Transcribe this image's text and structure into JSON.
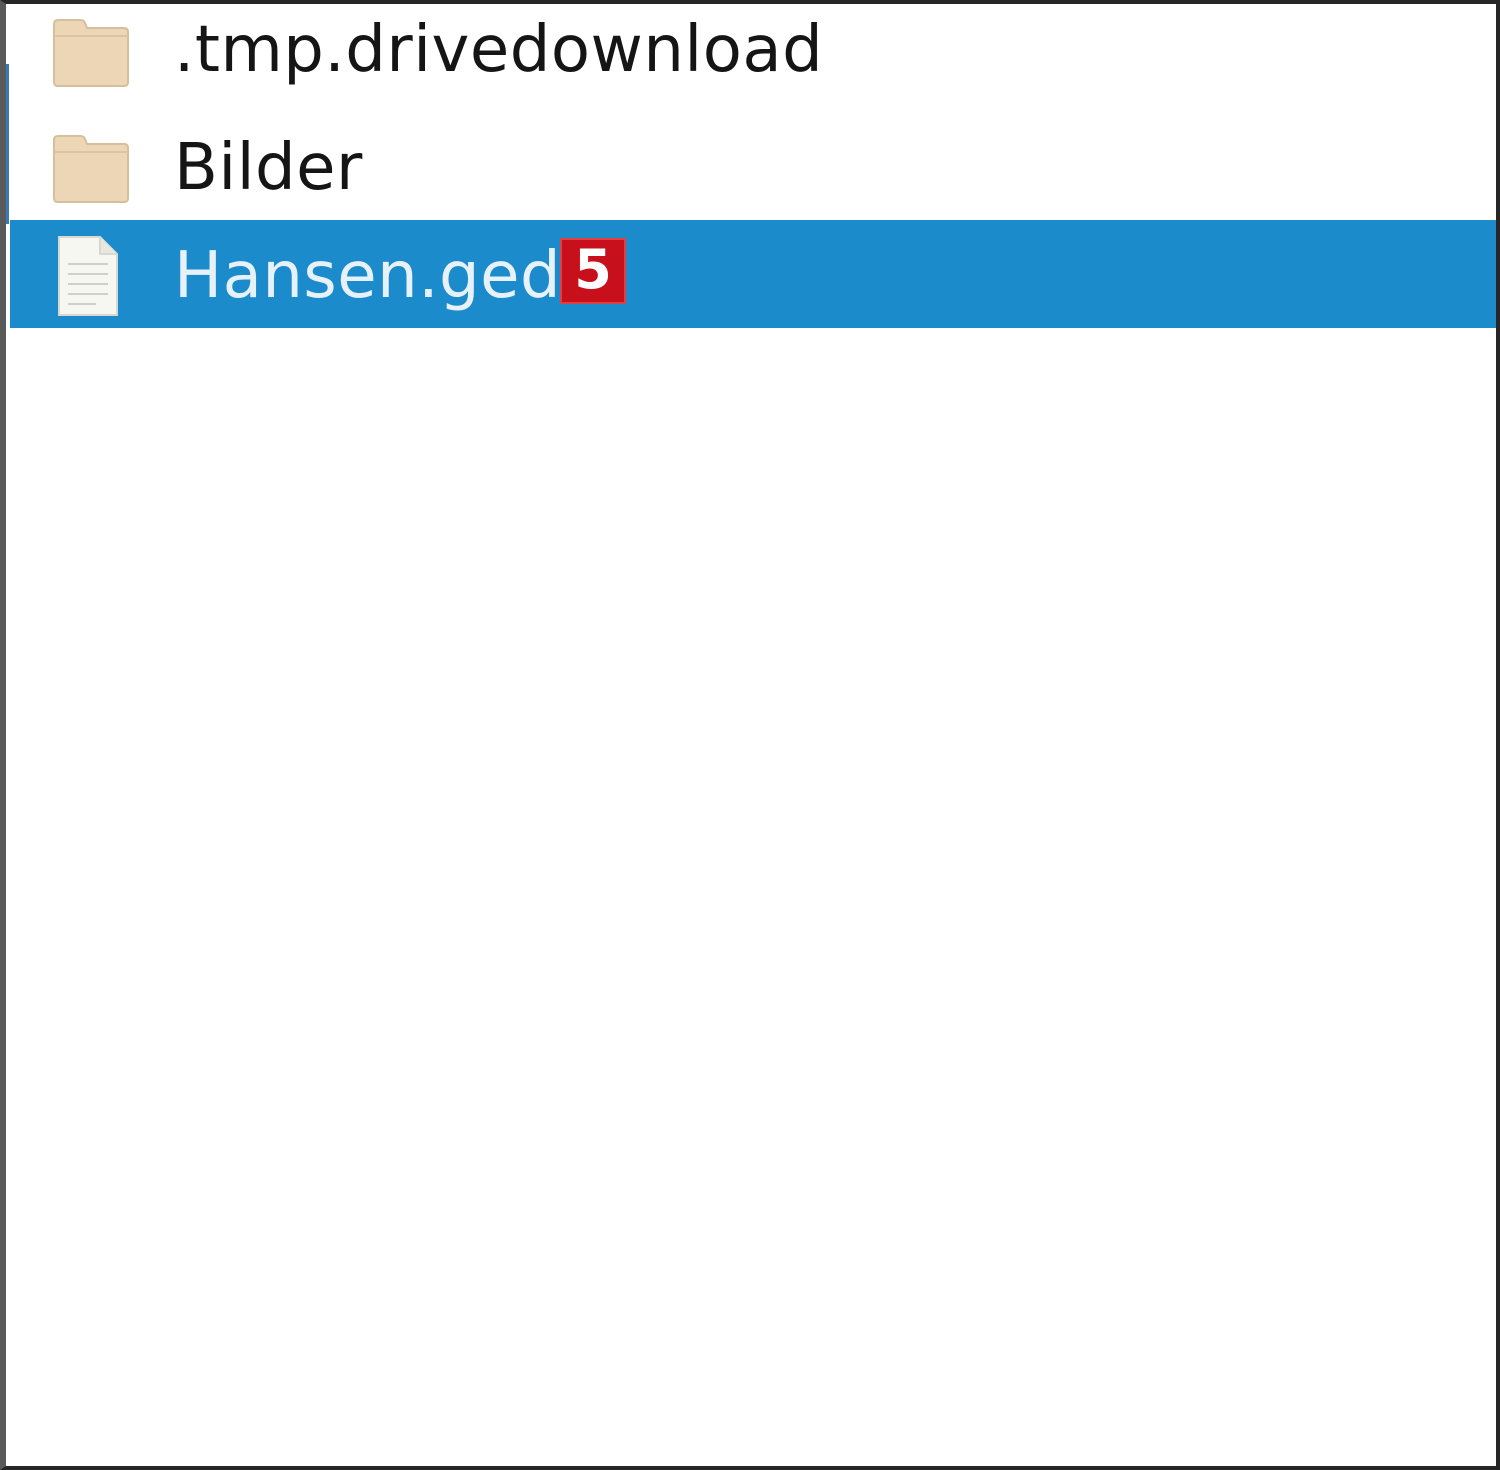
{
  "file_list": {
    "items": [
      {
        "name": ".tmp.drivedownload",
        "icon": "folder-icon",
        "selected": false
      },
      {
        "name": "Bilder",
        "icon": "folder-icon",
        "selected": false
      },
      {
        "name": "Hansen.ged",
        "icon": "document-icon",
        "selected": true,
        "badge": "5"
      }
    ]
  },
  "colors": {
    "selection": "#1c8bcc",
    "badge": "#c8101c",
    "folder": "#f0dcbf",
    "folder_edge": "#d4bfa0"
  }
}
